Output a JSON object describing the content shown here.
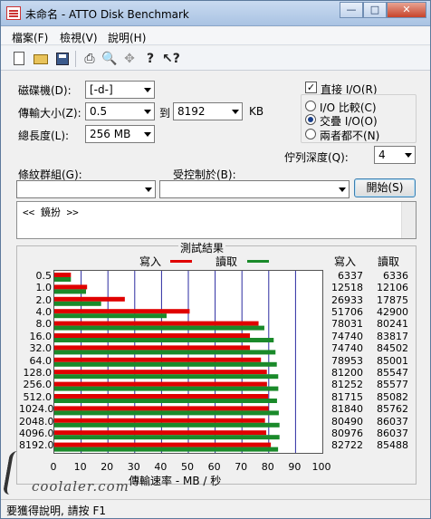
{
  "window": {
    "title": "未命名 - ATTO Disk Benchmark",
    "min": "—",
    "max": "□",
    "close": "✕"
  },
  "menu": [
    "檔案(F)",
    "檢視(V)",
    "說明(H)"
  ],
  "toolbar": {
    "icons": [
      "new-doc-icon",
      "open-folder-icon",
      "save-icon",
      "print-icon",
      "print-preview-icon",
      "move-icon",
      "help-icon",
      "context-help-icon"
    ]
  },
  "form": {
    "drive_label": "磁碟機(D):",
    "drive_value": "[-d-]",
    "transfer_label": "傳輸大小(Z):",
    "transfer_from": "0.5",
    "transfer_to_label": "到",
    "transfer_to": "8192",
    "transfer_unit": "KB",
    "length_label": "總長度(L):",
    "length_value": "256 MB",
    "direct_io_label": "直接 I/O(R)",
    "direct_io_checked": true,
    "io_compare": "I/O 比較(C)",
    "io_overlap": "交疊 I/O(O)",
    "io_neither": "兩者都不(N)",
    "queue_label": "佇列深度(Q):",
    "queue_value": "4",
    "pattern_label": "條紋群組(G):",
    "pattern_value": "",
    "control_label": "受控制於(B):",
    "control_value": "",
    "start_button": "開始(S)",
    "log_text": "<< 鏡扮 >>"
  },
  "results": {
    "title": "測試結果",
    "legend_write": "寫入",
    "legend_read": "讀取",
    "col_write": "寫入",
    "col_read": "讀取",
    "xlabel": "傳輸速率 - MB / 秒",
    "colors": {
      "write": "#e00000",
      "read": "#1a8a2a"
    }
  },
  "chart_data": {
    "type": "bar",
    "orientation": "horizontal",
    "categories": [
      "0.5",
      "1.0",
      "2.0",
      "4.0",
      "8.0",
      "16.0",
      "32.0",
      "64.0",
      "128.0",
      "256.0",
      "512.0",
      "1024.0",
      "2048.0",
      "4096.0",
      "8192.0"
    ],
    "series": [
      {
        "name": "寫入",
        "values": [
          6337,
          12518,
          26933,
          51706,
          78031,
          74740,
          74740,
          78953,
          81200,
          81252,
          81715,
          81840,
          80490,
          80976,
          82722
        ]
      },
      {
        "name": "讀取",
        "values": [
          6336,
          12106,
          17875,
          42900,
          80241,
          83817,
          84502,
          85001,
          85547,
          85577,
          85082,
          85762,
          86037,
          86037,
          85488
        ]
      }
    ],
    "xlabel": "傳輸速率 - MB / 秒",
    "xlim": [
      0,
      100
    ],
    "xticks": [
      "0",
      "10",
      "20",
      "30",
      "40",
      "50",
      "60",
      "70",
      "80",
      "90",
      "100"
    ],
    "grid": true
  },
  "status": "要獲得說明, 請按 F1",
  "watermark": "coolaler.com"
}
